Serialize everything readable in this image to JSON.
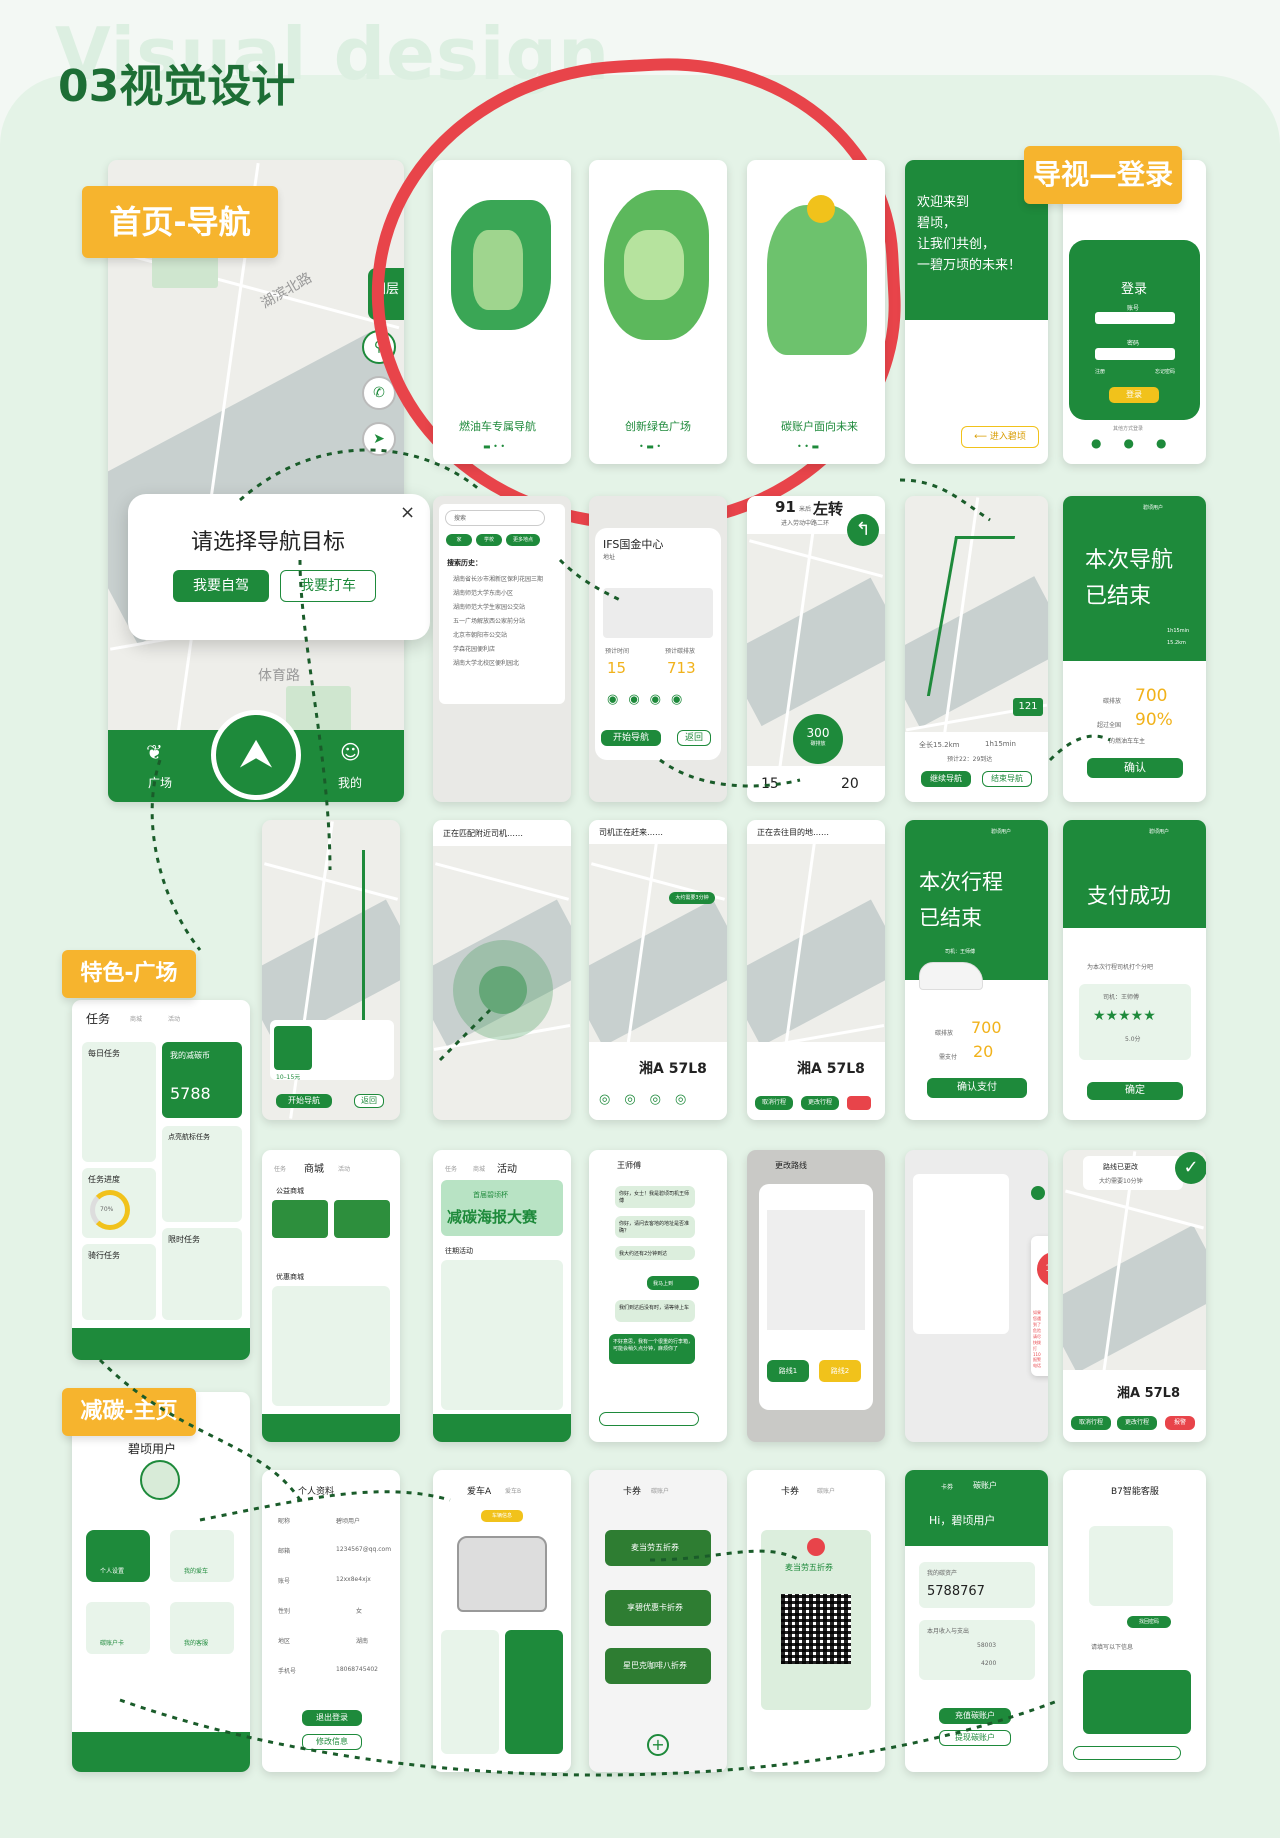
{
  "header": {
    "watermark": "Visual design",
    "title": "03视觉设计"
  },
  "tags": {
    "home_nav": "首页-导航",
    "guide_login": "导视—登录",
    "plaza": "特色-广场",
    "carbon_home": "减碳-主页"
  },
  "nav_dialog": {
    "title": "请选择导航目标",
    "self_drive": "我要自驾",
    "taxi": "我要打车",
    "close": "×"
  },
  "home": {
    "layers": "图层",
    "tabs": [
      "广场",
      "首页",
      "我的"
    ],
    "roads": [
      "湖滨北路",
      "体育路"
    ]
  },
  "onboarding": [
    {
      "caption": "燃油车专属导航"
    },
    {
      "caption": "创新绿色广场"
    },
    {
      "caption": "碳账户面向未来"
    }
  ],
  "welcome": {
    "lines": [
      "欢迎来到",
      "碧顷，",
      "让我们共创，",
      "一碧万顷的未来！"
    ],
    "enter": "进入碧顷"
  },
  "login": {
    "title": "登录",
    "account": "账号",
    "password": "密码",
    "register": "注册",
    "forgot": "忘记密码",
    "button": "登录",
    "other": "其他方式登录"
  },
  "search": {
    "placeholder": "搜索",
    "chips": [
      "家",
      "学校",
      "更多地点"
    ],
    "history_title": "搜索历史：",
    "history": [
      "湖南省长沙市湘新区保利花园三期",
      "湖南师范大学东南小区",
      "湖南师范大学生家园公交站",
      "五一广场解放西公家前分站",
      "北京市朝阳市公交站",
      "学森花园便利店",
      "湖南大学北校区便利园北"
    ]
  },
  "place": {
    "name": "IFS国金中心",
    "addr_label": "地址",
    "time_label": "预计时间",
    "carbon_label": "预计碳排放",
    "time": "15",
    "carbon": "713",
    "start": "开始导航",
    "back": "返回"
  },
  "turn": {
    "distance": "91",
    "unit": "米后",
    "dir": "左转",
    "road": "进入劳动中路二环",
    "speed": "300",
    "speed_label": "碳排放",
    "left": "15",
    "right": "20"
  },
  "route": {
    "dist": "全长15.2km",
    "time": "1h15min",
    "note": "预计22：29到达",
    "speed": "121",
    "continue": "继续导航",
    "end": "结束导航"
  },
  "nav_end": {
    "title1": "本次导航",
    "title2": "已结束",
    "time": "1h15min",
    "dist": "15.2km",
    "carbon_label": "碳排放",
    "carbon": "700",
    "beat": "超过全国",
    "pct": "90%",
    "beat2": "的燃油车车主",
    "confirm": "确认",
    "user": "碧顷用户"
  },
  "taxi": {
    "start": "开始导航",
    "back": "返回",
    "tag": "10–15元"
  },
  "matching": {
    "title": "正在匹配附近司机……"
  },
  "coming": {
    "title": "司机正在赶来……",
    "plate": "湘A 57L8",
    "badge": "大约需要3分钟"
  },
  "going": {
    "title": "正在去往目的地……",
    "plate": "湘A 57L8",
    "actions": [
      "取消行程",
      "更改行程"
    ]
  },
  "trip_end": {
    "title1": "本次行程",
    "title2": "已结束",
    "driver": "司机：王师傅",
    "carbon_label": "碳排放",
    "carbon": "700",
    "pay_label": "需支付",
    "pay": "20",
    "confirm": "确认支付",
    "user": "碧顷用户"
  },
  "paid": {
    "title": "支付成功",
    "rate": "为本次行程司机打个分吧",
    "driver": "司机：王师傅",
    "score": "5.0分",
    "confirm": "确定",
    "user": "碧顷用户"
  },
  "tasks": {
    "tabs": [
      "任务",
      "商城",
      "活动"
    ],
    "daily": "每日任务",
    "my_coin": "我的减碳币",
    "coins": "5788",
    "progress": "任务进度",
    "pct": "70%",
    "ride": "骑行任务",
    "limit": "限时任务",
    "nav_task": "点亮航标任务"
  },
  "mall": {
    "tabs": [
      "任务",
      "商城",
      "活动"
    ],
    "charity": "公益商城",
    "premium": "优惠商城"
  },
  "activity": {
    "tabs": [
      "任务",
      "商城",
      "活动"
    ],
    "cup": "首届碧顷杯",
    "poster": "减碳海报大赛",
    "past": "往期活动"
  },
  "chat": {
    "name": "王师傅",
    "msgs": [
      "你好，女士！我是碧顷司机王师傅",
      "你好，请问去客地的地址是否准确？",
      "我大约还有2分钟到达",
      "我马上到",
      "我们到达后没有时，请等待上车",
      "不好意思，我有一个很重的行李箱，可能会稍久点分钟，麻烦你了"
    ]
  },
  "change_route": {
    "title": "更改路线",
    "route1": "路线1",
    "route2": "路线2"
  },
  "sos": {
    "number": "110",
    "note": "如果您遇到了危险请尽快拨打110报警电话"
  },
  "route_changed": {
    "title": "路线已更改",
    "sub": "大约需要10分钟",
    "plate": "湘A 57L8",
    "actions": [
      "取消行程",
      "更改行程",
      "报警"
    ]
  },
  "profile": {
    "name": "碧顷用户",
    "items": [
      "个人设置",
      "我的爱车",
      "碳账户卡",
      "我的客服"
    ]
  },
  "personal": {
    "title": "个人资料",
    "rows": [
      [
        "昵称",
        "碧顷用户"
      ],
      [
        "邮箱",
        "1234567@qq.com"
      ],
      [
        "账号",
        "12xx8e4xjx"
      ],
      [
        "性别",
        "女"
      ],
      [
        "地区",
        "湖南"
      ],
      [
        "手机号",
        "18068745402"
      ]
    ],
    "logout": "退出登录",
    "edit": "修改信息"
  },
  "car": {
    "title": "爱车A",
    "tab2": "爱车B",
    "badge": "车辆信息"
  },
  "coupons": {
    "tabs": [
      "卡券",
      "碳账户"
    ],
    "items": [
      "麦当劳五折券",
      "享碧优惠卡折券",
      "星巴克咖啡八折券"
    ]
  },
  "coupon_detail": {
    "title": "卡券",
    "tab2": "碳账户",
    "name": "麦当劳五折券"
  },
  "carbon_acc": {
    "tabs": [
      "卡券",
      "碳账户"
    ],
    "hi": "Hi，碧顷用户",
    "label": "我的碳资产",
    "value": "5788767",
    "month": "本月收入与支出",
    "in": "58003",
    "out": "4200",
    "recharge": "充值碳账户",
    "withdraw": "提现碳账户"
  },
  "support": {
    "title": "B7智能客服",
    "find": "找回密码",
    "q": "请填写以下信息"
  }
}
